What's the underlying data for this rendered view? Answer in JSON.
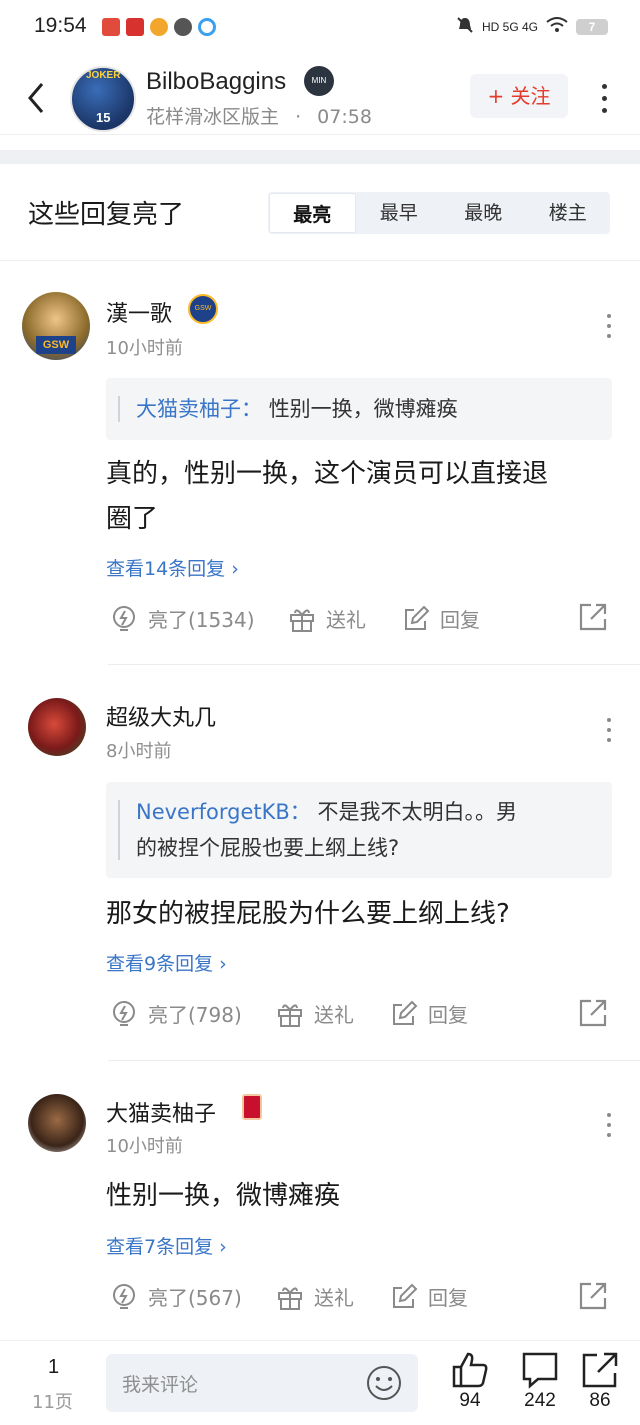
{
  "status_bar": {
    "time": "19:54",
    "app_icons": [
      "头条",
      "彩",
      "微博",
      "●",
      "◎"
    ],
    "network": "HD 5G 4G",
    "battery": "7"
  },
  "header": {
    "username": "BilboBaggins",
    "badge": "MIN",
    "avatar_text": [
      "JOKER",
      "15"
    ],
    "subtitle": "花样滑冰区版主",
    "separator": "·",
    "time": "07:58",
    "follow_label": "+ 关注"
  },
  "section": {
    "title": "这些回复亮了",
    "sort_tabs": [
      "最亮",
      "最早",
      "最晚",
      "楼主"
    ],
    "active_tab": "最亮"
  },
  "comments": [
    {
      "name": "漢一歌",
      "time": "10小时前",
      "quote_author": "大猫卖柚子：",
      "quote_text": "性别一换，微博瘫痪",
      "body_lines": [
        "真的，性别一换，这个演员可以直接退",
        "圈了"
      ],
      "view_replies": "查看14条回复",
      "likes": "亮了(1534)",
      "gift": "送礼",
      "reply": "回复"
    },
    {
      "name": "超级大丸几",
      "time": "8小时前",
      "quote_author": "NeverforgetKB：",
      "quote_text": "不是我不太明白。。男",
      "quote_text_2": "的被捏个屁股也要上纲上线?",
      "body_lines": [
        "那女的被捏屁股为什么要上纲上线?"
      ],
      "view_replies": "查看9条回复",
      "likes": "亮了(798)",
      "gift": "送礼",
      "reply": "回复"
    },
    {
      "name": "大猫卖柚子",
      "time": "10小时前",
      "body_lines": [
        "性别一换，微博瘫痪"
      ],
      "view_replies": "查看7条回复",
      "likes": "亮了(567)",
      "gift": "送礼",
      "reply": "回复"
    }
  ],
  "bottom_bar": {
    "page_current": "1",
    "page_total": "11页",
    "comment_placeholder": "我来评论",
    "like_count": "94",
    "comment_count": "242",
    "share_count": "86"
  },
  "colors": {
    "accent_blue": "#3a76c8",
    "follow_red": "#e43c2c",
    "muted_gray": "#8a8a8a"
  }
}
